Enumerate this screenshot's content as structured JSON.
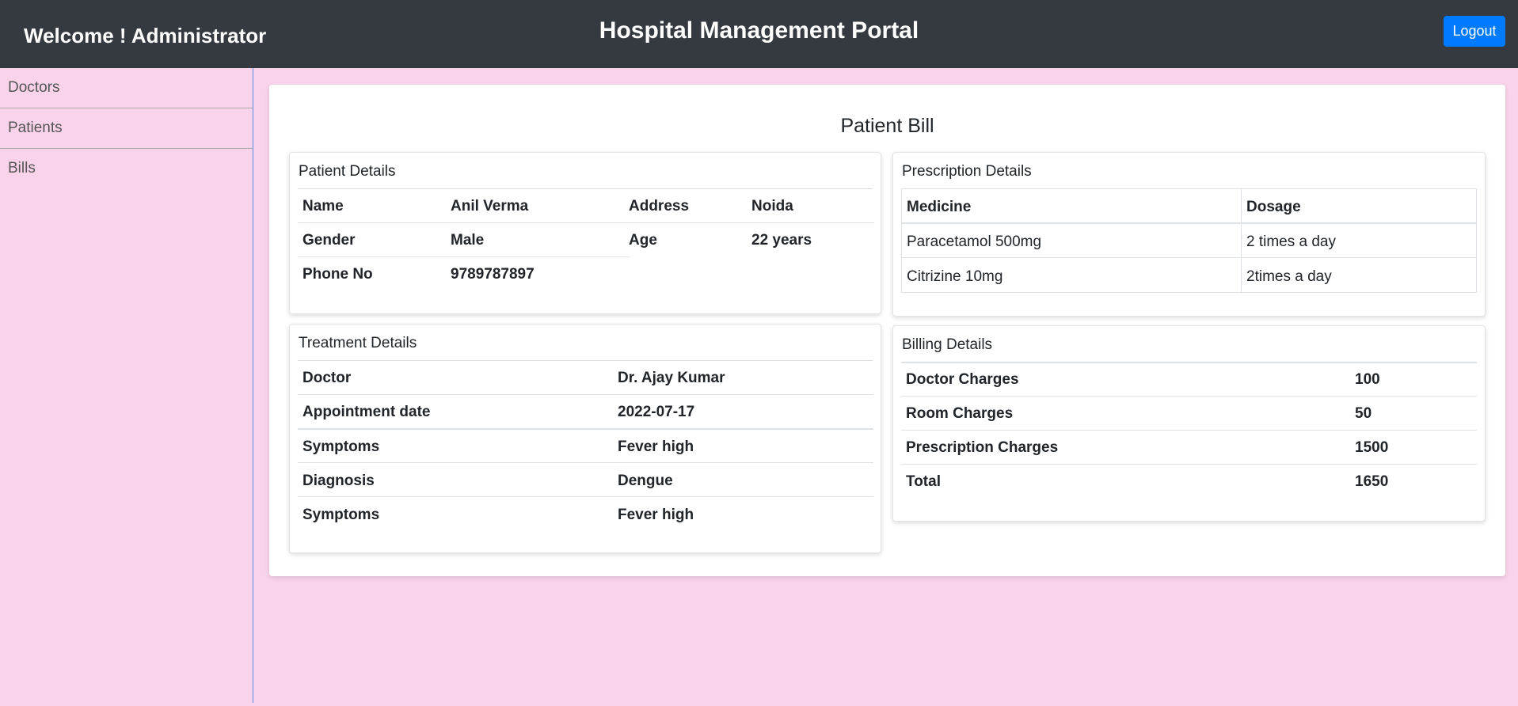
{
  "header": {
    "welcome": "Welcome ! Administrator",
    "title": "Hospital Management Portal",
    "logout_label": "Logout"
  },
  "sidebar": {
    "items": [
      {
        "label": "Doctors"
      },
      {
        "label": "Patients"
      },
      {
        "label": "Bills"
      }
    ]
  },
  "bill": {
    "title": "Patient Bill",
    "patient": {
      "heading": "Patient Details",
      "name_label": "Name",
      "name": "Anil Verma",
      "address_label": "Address",
      "address": "Noida",
      "gender_label": "Gender",
      "gender": "Male",
      "age_label": "Age",
      "age": "22 years",
      "phone_label": "Phone No",
      "phone": "9789787897"
    },
    "prescription": {
      "heading": "Prescription Details",
      "columns": [
        "Medicine",
        "Dosage"
      ],
      "rows": [
        {
          "medicine": "Paracetamol 500mg",
          "dosage": "2 times a day"
        },
        {
          "medicine": "Citrizine 10mg",
          "dosage": "2times a day"
        }
      ]
    },
    "treatment": {
      "heading": "Treatment Details",
      "rows": [
        {
          "label": "Doctor",
          "value": "Dr. Ajay Kumar"
        },
        {
          "label": "Appointment date",
          "value": "2022-07-17"
        },
        {
          "label": "Symptoms",
          "value": "Fever high"
        },
        {
          "label": "Diagnosis",
          "value": "Dengue"
        },
        {
          "label": "Symptoms",
          "value": "Fever high"
        }
      ]
    },
    "billing": {
      "heading": "Billing Details",
      "rows": [
        {
          "label": "Doctor Charges",
          "value": "100"
        },
        {
          "label": "Room Charges",
          "value": "50"
        },
        {
          "label": "Prescription Charges",
          "value": "1500"
        },
        {
          "label": "Total",
          "value": "1650"
        }
      ]
    }
  }
}
